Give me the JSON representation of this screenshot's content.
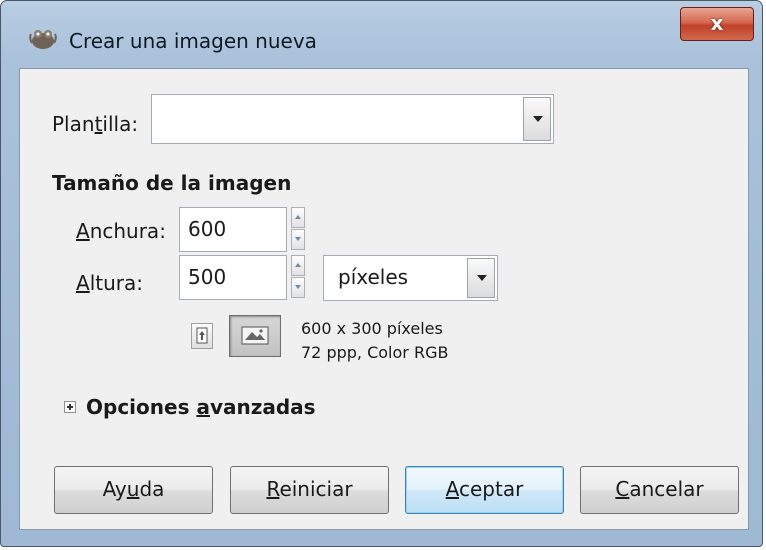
{
  "window": {
    "title": "Crear una imagen nueva",
    "close_label": "x"
  },
  "template": {
    "label_pre": "Plan",
    "label_key": "t",
    "label_post": "illa:",
    "value": ""
  },
  "image_size": {
    "heading": "Tamaño de la imagen",
    "width_label_key": "A",
    "width_label_rest": "nchura:",
    "width_value": "600",
    "height_label_key": "A",
    "height_label_rest": "ltura:",
    "height_value": "500",
    "unit": "píxeles",
    "info_line1": "600 x 300 píxeles",
    "info_line2": "72 ppp, Color RGB"
  },
  "advanced": {
    "label_pre": "Opciones ",
    "label_key": "a",
    "label_post": "vanzadas"
  },
  "buttons": {
    "help_pre": "Ay",
    "help_key": "u",
    "help_post": "da",
    "reset_key": "R",
    "reset_rest": "einiciar",
    "accept_key": "A",
    "accept_rest": "ceptar",
    "cancel_key": "C",
    "cancel_rest": "ancelar"
  }
}
